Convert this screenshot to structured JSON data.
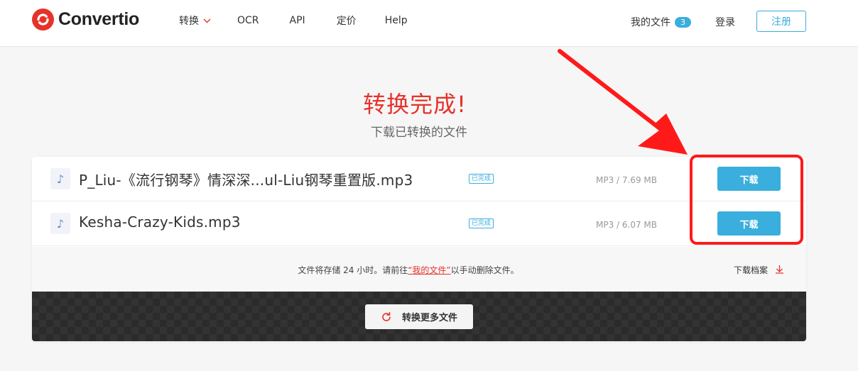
{
  "brand": {
    "name": "Convertio",
    "accent": "#e6332a",
    "blue": "#3aaedc"
  },
  "nav": {
    "items": [
      {
        "label": "转换",
        "has_dropdown": true
      },
      {
        "label": "OCR"
      },
      {
        "label": "API"
      },
      {
        "label": "定价"
      },
      {
        "label": "Help"
      }
    ]
  },
  "header_right": {
    "my_files_label": "我的文件",
    "my_files_count": "3",
    "login_label": "登录",
    "register_label": "注册"
  },
  "main": {
    "title": "转换完成!",
    "subtitle": "下载已转换的文件"
  },
  "files": [
    {
      "icon": "music-note-icon",
      "name": "P_Liu-《流行钢琴》情深深...ul-Liu钢琴重置版.mp3",
      "status": "已完成",
      "size": "MP3 / 7.69 MB",
      "download_label": "下载"
    },
    {
      "icon": "music-note-icon",
      "name": "Kesha-Crazy-Kids.mp3",
      "status": "已完成",
      "size": "MP3 / 6.07 MB",
      "download_label": "下载"
    }
  ],
  "info": {
    "prefix": "文件将存储 24 小时。请前往",
    "link": "“我的文件”",
    "suffix": "以手动删除文件。",
    "archive_label": "下载档案"
  },
  "convert_more_label": "转换更多文件",
  "annotation": {
    "color": "#ff1a1a"
  }
}
